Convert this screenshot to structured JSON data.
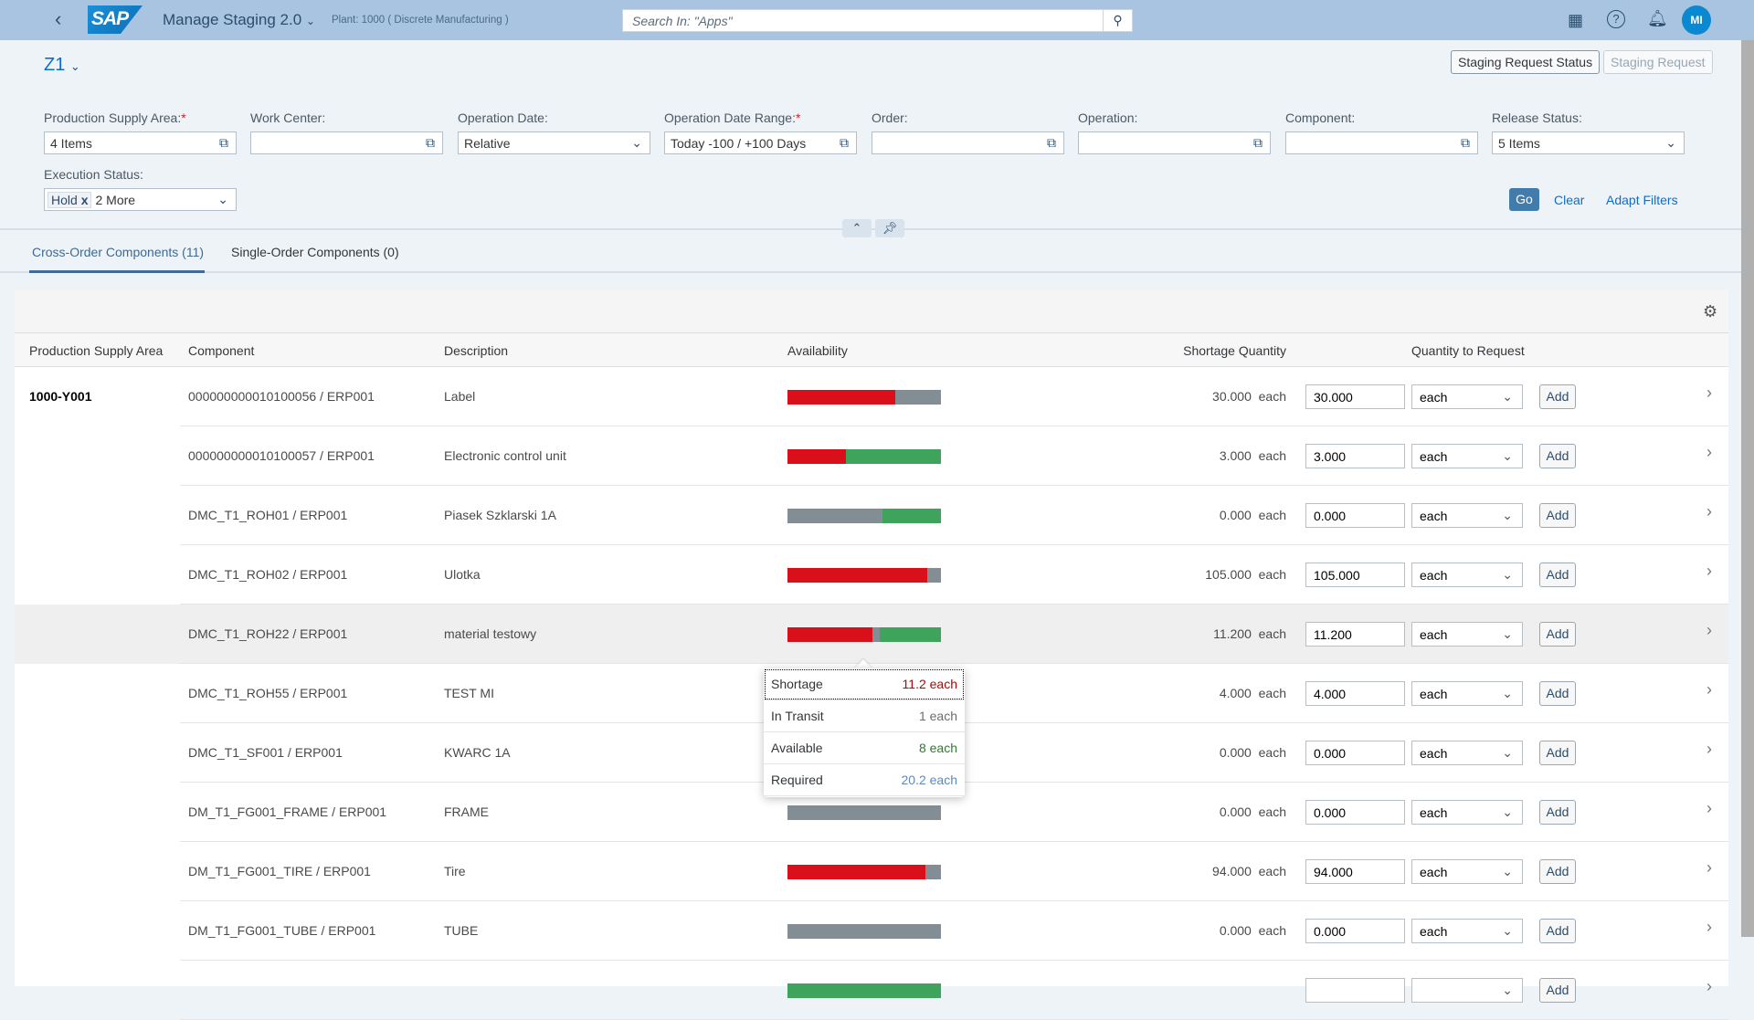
{
  "shell": {
    "app_title": "Manage Staging 2.0",
    "plant": "Plant: 1000 ( Discrete Manufacturing )",
    "search_placeholder": "Search In: \"Apps\"",
    "avatar": "MI",
    "logo": "SAP"
  },
  "header": {
    "variant": "Z1",
    "staging_request_status": "Staging Request Status",
    "staging_request": "Staging Request"
  },
  "filters": [
    {
      "label": "Production Supply Area:",
      "required": "*",
      "value": "4 Items",
      "type": "valuehelp"
    },
    {
      "label": "Work Center:",
      "required": "",
      "value": "",
      "type": "valuehelp"
    },
    {
      "label": "Operation Date:",
      "required": "",
      "value": "Relative",
      "type": "select"
    },
    {
      "label": "Operation Date Range:",
      "required": "*",
      "value": "Today -100 / +100 Days",
      "type": "valuehelp"
    },
    {
      "label": "Order:",
      "required": "",
      "value": "",
      "type": "valuehelp"
    },
    {
      "label": "Operation:",
      "required": "",
      "value": "",
      "type": "valuehelp"
    },
    {
      "label": "Component:",
      "required": "",
      "value": "",
      "type": "valuehelp"
    },
    {
      "label": "Release Status:",
      "required": "",
      "value": "5 Items",
      "type": "select"
    }
  ],
  "execution_status": {
    "label": "Execution Status:",
    "token": "Hold",
    "token_remove": "x",
    "more": "2 More"
  },
  "filter_actions": {
    "go": "Go",
    "clear": "Clear",
    "adapt": "Adapt Filters"
  },
  "tabs": [
    {
      "label": "Cross-Order Components (11)",
      "active": true
    },
    {
      "label": "Single-Order Components (0)",
      "active": false
    }
  ],
  "table": {
    "columns": [
      "Production Supply Area",
      "Component",
      "Description",
      "Availability",
      "Shortage Quantity",
      "Quantity to Request"
    ],
    "colors": {
      "shortage": "#d9101a",
      "other": "#838e94",
      "available": "#3fa45b"
    },
    "rows": [
      {
        "psa": "1000-Y001",
        "component": "000000000010100056 / ERP001",
        "description": "Label",
        "availability": [
          [
            "shortage",
            0.7
          ],
          [
            "other",
            0.3
          ]
        ],
        "shortage": "30.000",
        "unit": "each",
        "qty": "30.000",
        "qty_unit": "each"
      },
      {
        "psa": "",
        "component": "000000000010100057 / ERP001",
        "description": "Electronic control unit",
        "availability": [
          [
            "shortage",
            0.38
          ],
          [
            "available",
            0.62
          ]
        ],
        "shortage": "3.000",
        "unit": "each",
        "qty": "3.000",
        "qty_unit": "each"
      },
      {
        "psa": "",
        "component": "DMC_T1_ROH01 / ERP001",
        "description": "Piasek Szklarski 1A",
        "availability": [
          [
            "other",
            0.62
          ],
          [
            "available",
            0.38
          ]
        ],
        "shortage": "0.000",
        "unit": "each",
        "qty": "0.000",
        "qty_unit": "each"
      },
      {
        "psa": "",
        "component": "DMC_T1_ROH02 / ERP001",
        "description": "Ulotka",
        "availability": [
          [
            "shortage",
            0.91
          ],
          [
            "other",
            0.09
          ]
        ],
        "shortage": "105.000",
        "unit": "each",
        "qty": "105.000",
        "qty_unit": "each"
      },
      {
        "psa": "",
        "component": "DMC_T1_ROH22 / ERP001",
        "description": "material testowy",
        "availability": [
          [
            "shortage",
            0.554
          ],
          [
            "other",
            0.05
          ],
          [
            "available",
            0.396
          ]
        ],
        "shortage": "11.200",
        "unit": "each",
        "qty": "11.200",
        "qty_unit": "each",
        "selected": true
      },
      {
        "psa": "",
        "component": "DMC_T1_ROH55 / ERP001",
        "description": "TEST MI",
        "availability": [],
        "shortage": "4.000",
        "unit": "each",
        "qty": "4.000",
        "qty_unit": "each"
      },
      {
        "psa": "",
        "component": "DMC_T1_SF001 / ERP001",
        "description": "KWARC 1A",
        "availability": [],
        "shortage": "0.000",
        "unit": "each",
        "qty": "0.000",
        "qty_unit": "each"
      },
      {
        "psa": "",
        "component": "DM_T1_FG001_FRAME / ERP001",
        "description": "FRAME",
        "availability": [
          [
            "other",
            1
          ]
        ],
        "shortage": "0.000",
        "unit": "each",
        "qty": "0.000",
        "qty_unit": "each"
      },
      {
        "psa": "",
        "component": "DM_T1_FG001_TIRE / ERP001",
        "description": "Tire",
        "availability": [
          [
            "shortage",
            0.9
          ],
          [
            "other",
            0.1
          ]
        ],
        "shortage": "94.000",
        "unit": "each",
        "qty": "94.000",
        "qty_unit": "each"
      },
      {
        "psa": "",
        "component": "DM_T1_FG001_TUBE / ERP001",
        "description": "TUBE",
        "availability": [
          [
            "other",
            1
          ]
        ],
        "shortage": "0.000",
        "unit": "each",
        "qty": "0.000",
        "qty_unit": "each"
      },
      {
        "psa": "",
        "component": "",
        "description": "",
        "availability": [
          [
            "available",
            1
          ]
        ],
        "shortage": "",
        "unit": "",
        "qty": "",
        "qty_unit": ""
      }
    ],
    "add_label": "Add"
  },
  "tooltip": {
    "rows": [
      {
        "label": "Shortage",
        "value": "11.2 each",
        "color": "#bb0000"
      },
      {
        "label": "In Transit",
        "value": "1 each",
        "color": "#6a6d70"
      },
      {
        "label": "Available",
        "value": "8 each",
        "color": "#2b7c2b"
      },
      {
        "label": "Required",
        "value": "20.2 each",
        "color": "#5b8ab8"
      }
    ]
  }
}
